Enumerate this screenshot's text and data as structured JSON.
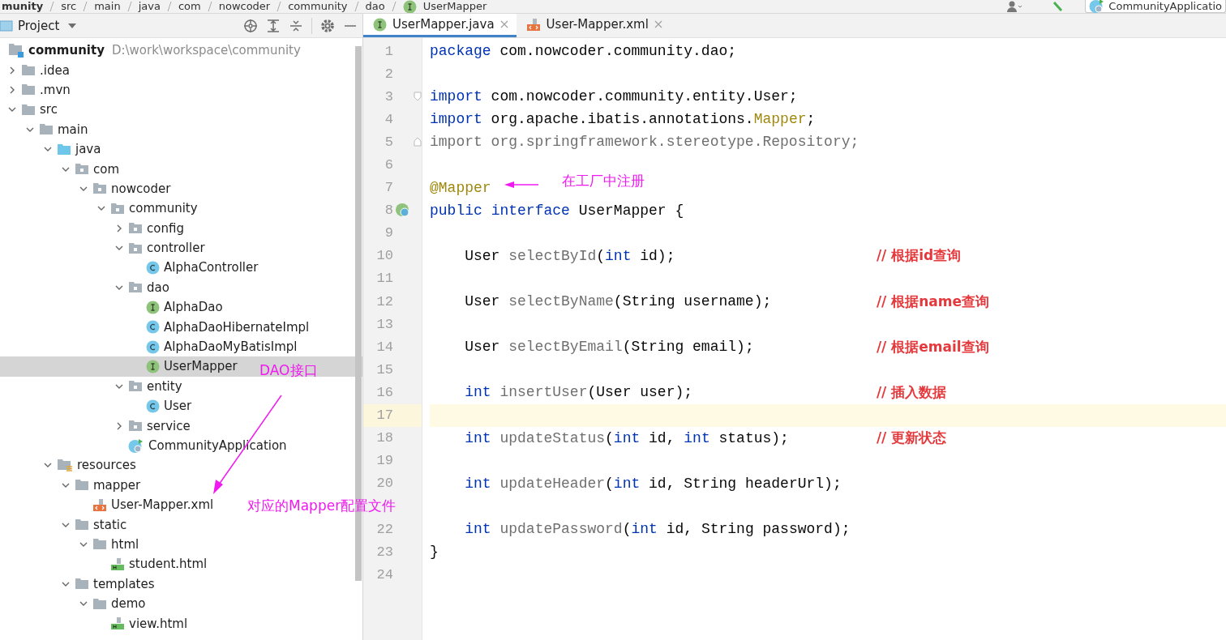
{
  "breadcrumb": [
    "munity",
    "src",
    "main",
    "java",
    "com",
    "nowcoder",
    "community",
    "dao",
    "UserMapper"
  ],
  "toolbar": {
    "run_config": "CommunityApplicatio"
  },
  "project_panel": {
    "title": "Project",
    "root": {
      "name": "community",
      "path": "D:\\work\\workspace\\community"
    },
    "tree": [
      {
        "name": ".idea",
        "kind": "folder",
        "expanded": false,
        "selected": false
      },
      {
        "name": ".mvn",
        "kind": "folder",
        "expanded": false,
        "selected": false
      },
      {
        "name": "src",
        "kind": "folder",
        "expanded": true,
        "selected": false,
        "children": [
          {
            "name": "main",
            "kind": "folder",
            "expanded": true,
            "selected": false,
            "children": [
              {
                "name": "java",
                "kind": "source",
                "expanded": true,
                "selected": false,
                "children": [
                  {
                    "name": "com",
                    "kind": "package",
                    "expanded": true,
                    "selected": false,
                    "children": [
                      {
                        "name": "nowcoder",
                        "kind": "package",
                        "expanded": true,
                        "selected": false,
                        "children": [
                          {
                            "name": "community",
                            "kind": "package",
                            "expanded": true,
                            "selected": false,
                            "children": [
                              {
                                "name": "config",
                                "kind": "package",
                                "expanded": false,
                                "selected": false
                              },
                              {
                                "name": "controller",
                                "kind": "package",
                                "expanded": true,
                                "selected": false,
                                "children": [
                                  {
                                    "name": "AlphaController",
                                    "kind": "class",
                                    "selected": false
                                  }
                                ]
                              },
                              {
                                "name": "dao",
                                "kind": "package",
                                "expanded": true,
                                "selected": false,
                                "children": [
                                  {
                                    "name": "AlphaDao",
                                    "kind": "interface",
                                    "selected": false
                                  },
                                  {
                                    "name": "AlphaDaoHibernateImpl",
                                    "kind": "class",
                                    "selected": false
                                  },
                                  {
                                    "name": "AlphaDaoMyBatisImpl",
                                    "kind": "class",
                                    "selected": false
                                  },
                                  {
                                    "name": "UserMapper",
                                    "kind": "interface",
                                    "selected": true
                                  }
                                ]
                              },
                              {
                                "name": "entity",
                                "kind": "package",
                                "expanded": true,
                                "selected": false,
                                "children": [
                                  {
                                    "name": "User",
                                    "kind": "class",
                                    "selected": false
                                  }
                                ]
                              },
                              {
                                "name": "service",
                                "kind": "package",
                                "expanded": false,
                                "selected": false
                              },
                              {
                                "name": "CommunityApplication",
                                "kind": "app",
                                "selected": false
                              }
                            ]
                          }
                        ]
                      }
                    ]
                  }
                ]
              },
              {
                "name": "resources",
                "kind": "resources",
                "expanded": true,
                "selected": false,
                "children": [
                  {
                    "name": "mapper",
                    "kind": "folder",
                    "expanded": true,
                    "selected": false,
                    "children": [
                      {
                        "name": "User-Mapper.xml",
                        "kind": "xml",
                        "selected": false
                      }
                    ]
                  },
                  {
                    "name": "static",
                    "kind": "folder",
                    "expanded": true,
                    "selected": false,
                    "children": [
                      {
                        "name": "html",
                        "kind": "folder",
                        "expanded": true,
                        "selected": false,
                        "children": [
                          {
                            "name": "student.html",
                            "kind": "html",
                            "selected": false
                          }
                        ]
                      }
                    ]
                  },
                  {
                    "name": "templates",
                    "kind": "folder",
                    "expanded": true,
                    "selected": false,
                    "children": [
                      {
                        "name": "demo",
                        "kind": "folder",
                        "expanded": true,
                        "selected": false,
                        "children": [
                          {
                            "name": "view.html",
                            "kind": "html",
                            "selected": false
                          }
                        ]
                      }
                    ]
                  }
                ]
              }
            ]
          }
        ]
      }
    ]
  },
  "tabs": [
    {
      "label": "UserMapper.java",
      "kind": "interface",
      "selected": true
    },
    {
      "label": "User-Mapper.xml",
      "kind": "xml",
      "selected": false
    }
  ],
  "editor": {
    "lines": [
      {
        "number": "1",
        "indented": false,
        "current": false,
        "tokens": [
          {
            "text": "package",
            "kind": "keyword"
          },
          {
            "text": " com.nowcoder.community.dao;",
            "kind": "plain"
          }
        ]
      },
      {
        "number": "2",
        "current": false
      },
      {
        "number": "3",
        "indented": false,
        "current": false,
        "fold_open": true,
        "tokens": [
          {
            "text": "import",
            "kind": "keyword"
          },
          {
            "text": " com.nowcoder.community.entity.User;",
            "kind": "plain"
          }
        ]
      },
      {
        "number": "4",
        "indented": false,
        "current": false,
        "tokens": [
          {
            "text": "import",
            "kind": "keyword"
          },
          {
            "text": " org.apache.ibatis.annotations.",
            "kind": "plain"
          },
          {
            "text": "Mapper",
            "kind": "annotation"
          },
          {
            "text": ";",
            "kind": "plain"
          }
        ]
      },
      {
        "number": "5",
        "indented": false,
        "current": false,
        "fold_close": true,
        "tokens": [
          {
            "text": "import org.springframework.stereotype.Repository;",
            "kind": "unused"
          }
        ]
      },
      {
        "number": "6",
        "current": false
      },
      {
        "number": "7",
        "indented": false,
        "current": false,
        "tokens": [
          {
            "text": "@Mapper",
            "kind": "annotation"
          }
        ]
      },
      {
        "number": "8",
        "indented": false,
        "current": false,
        "bean_marker": true,
        "tokens": [
          {
            "text": "public ",
            "kind": "keyword"
          },
          {
            "text": "interface",
            "kind": "keyword"
          },
          {
            "text": " UserMapper {",
            "kind": "plain"
          }
        ]
      },
      {
        "number": "9",
        "current": false
      },
      {
        "number": "10",
        "indented": true,
        "current": false,
        "tokens": [
          {
            "text": "User ",
            "kind": "plain"
          },
          {
            "text": "selectById",
            "kind": "unused"
          },
          {
            "text": "(",
            "kind": "plain"
          },
          {
            "text": "int",
            "kind": "keyword"
          },
          {
            "text": " id);",
            "kind": "plain"
          }
        ],
        "comment": "// 根据id查询"
      },
      {
        "number": "11",
        "current": false
      },
      {
        "number": "12",
        "indented": true,
        "current": false,
        "tokens": [
          {
            "text": "User ",
            "kind": "plain"
          },
          {
            "text": "selectByName",
            "kind": "unused"
          },
          {
            "text": "(String username);",
            "kind": "plain"
          }
        ],
        "comment": "// 根据name查询"
      },
      {
        "number": "13",
        "current": false
      },
      {
        "number": "14",
        "indented": true,
        "current": false,
        "tokens": [
          {
            "text": "User ",
            "kind": "plain"
          },
          {
            "text": "selectByEmail",
            "kind": "unused"
          },
          {
            "text": "(String email);",
            "kind": "plain"
          }
        ],
        "comment": "// 根据email查询"
      },
      {
        "number": "15",
        "current": false
      },
      {
        "number": "16",
        "indented": true,
        "current": false,
        "tokens": [
          {
            "text": "int ",
            "kind": "keyword"
          },
          {
            "text": "insertUser",
            "kind": "unused"
          },
          {
            "text": "(User user);",
            "kind": "plain"
          }
        ],
        "comment": "// 插入数据"
      },
      {
        "number": "17",
        "current": true
      },
      {
        "number": "18",
        "indented": true,
        "current": false,
        "tokens": [
          {
            "text": "int ",
            "kind": "keyword"
          },
          {
            "text": "updateStatus",
            "kind": "unused"
          },
          {
            "text": "(",
            "kind": "plain"
          },
          {
            "text": "int",
            "kind": "keyword"
          },
          {
            "text": " id, ",
            "kind": "plain"
          },
          {
            "text": "int",
            "kind": "keyword"
          },
          {
            "text": " status);",
            "kind": "plain"
          }
        ],
        "comment": "// 更新状态"
      },
      {
        "number": "19",
        "current": false
      },
      {
        "number": "20",
        "indented": true,
        "current": false,
        "tokens": [
          {
            "text": "int ",
            "kind": "keyword"
          },
          {
            "text": "updateHeader",
            "kind": "unused"
          },
          {
            "text": "(",
            "kind": "plain"
          },
          {
            "text": "int",
            "kind": "keyword"
          },
          {
            "text": " id, String headerUrl);",
            "kind": "plain"
          }
        ]
      },
      {
        "current": false
      },
      {
        "number": "22",
        "indented": true,
        "current": false,
        "tokens": [
          {
            "text": "int ",
            "kind": "keyword"
          },
          {
            "text": "updatePassword",
            "kind": "unused"
          },
          {
            "text": "(",
            "kind": "plain"
          },
          {
            "text": "int",
            "kind": "keyword"
          },
          {
            "text": " id, String password);",
            "kind": "plain"
          }
        ]
      },
      {
        "number": "23",
        "indented": false,
        "current": false,
        "tokens": [
          {
            "text": "}",
            "kind": "plain"
          }
        ]
      },
      {
        "number": "24",
        "current": false
      }
    ]
  },
  "annotations": [
    {
      "text": "在工厂中注册"
    },
    {
      "text": "DAO接口"
    },
    {
      "text": "对应的Mapper配置文件"
    }
  ]
}
